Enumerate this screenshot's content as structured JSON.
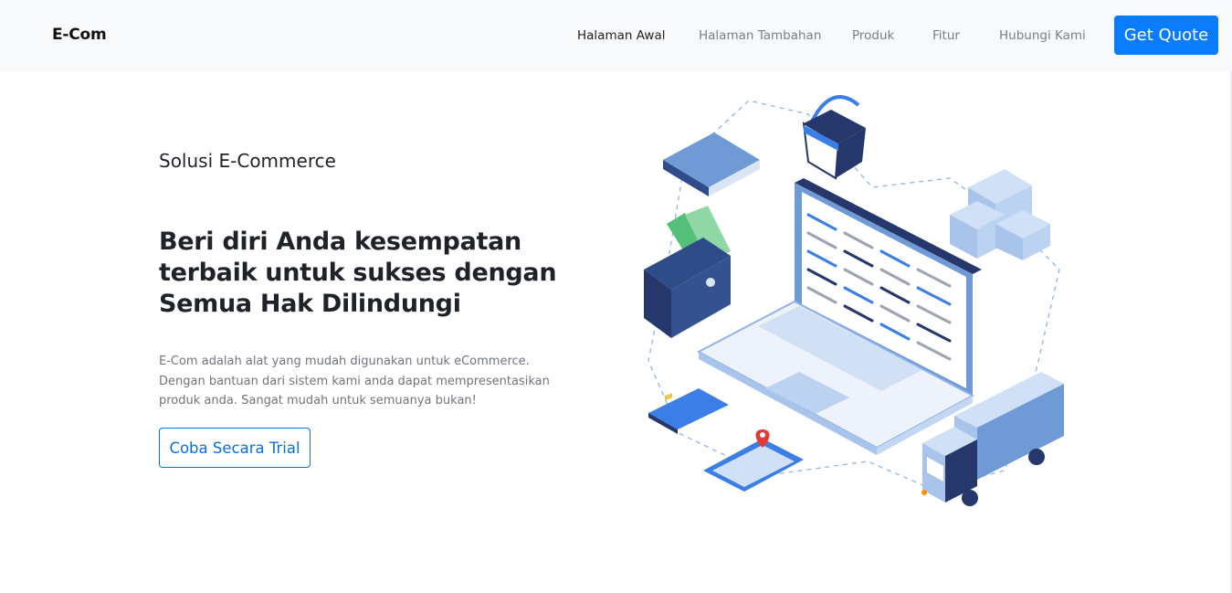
{
  "nav": {
    "brand": "E-Com",
    "links": [
      "Halaman Awal",
      "Halaman Tambahan",
      "Produk",
      "Fitur",
      "Hubungi Kami"
    ],
    "cta": "Get Quote"
  },
  "hero": {
    "eyebrow": "Solusi E-Commerce",
    "headline": "Beri diri Anda kesempatan terbaik untuk sukses dengan Semua Hak Dilindungi",
    "description": "E-Com adalah alat yang mudah digunakan untuk eCommerce. Dengan bantuan dari sistem kami anda dapat mempresentasikan produk anda. Sangat mudah untuk semuanya bukan!",
    "trial_button": "Coba Secara Trial"
  },
  "colors": {
    "primary": "#0a7cff",
    "navbar_bg": "#f8f9fa",
    "illustration_dark": "#26386b",
    "illustration_light": "#a9c4ea"
  }
}
